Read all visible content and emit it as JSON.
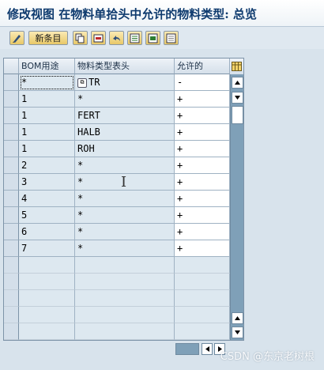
{
  "window": {
    "title": "修改视图 在物料单拾头中允许的物料类型: 总览"
  },
  "toolbar": {
    "new_entries_label": "新条目",
    "icons": [
      "change-display-icon",
      "copy-icon",
      "delete-icon",
      "undo-icon",
      "select-all-icon",
      "select-block-icon",
      "deselect-all-icon"
    ]
  },
  "table": {
    "headers": {
      "bom_usage": "BOM用途",
      "material_type": "物料类型表头",
      "allowed": "允许的"
    },
    "rows": [
      {
        "bom_usage": "*",
        "material_type": "TR",
        "allowed": "-"
      },
      {
        "bom_usage": "1",
        "material_type": "*",
        "allowed": "+"
      },
      {
        "bom_usage": "1",
        "material_type": "FERT",
        "allowed": "+"
      },
      {
        "bom_usage": "1",
        "material_type": "HALB",
        "allowed": "+"
      },
      {
        "bom_usage": "1",
        "material_type": "ROH",
        "allowed": "+"
      },
      {
        "bom_usage": "2",
        "material_type": "*",
        "allowed": "+"
      },
      {
        "bom_usage": "3",
        "material_type": "*",
        "allowed": "+"
      },
      {
        "bom_usage": "4",
        "material_type": "*",
        "allowed": "+"
      },
      {
        "bom_usage": "5",
        "material_type": "*",
        "allowed": "+"
      },
      {
        "bom_usage": "6",
        "material_type": "*",
        "allowed": "+"
      },
      {
        "bom_usage": "7",
        "material_type": "*",
        "allowed": "+"
      }
    ],
    "empty_rows": 5
  },
  "watermark": "CSDN @东京老树根",
  "colors": {
    "title": "#0e3a6e",
    "button": "#e8c868",
    "scrollbar": "#7fa0b8"
  }
}
